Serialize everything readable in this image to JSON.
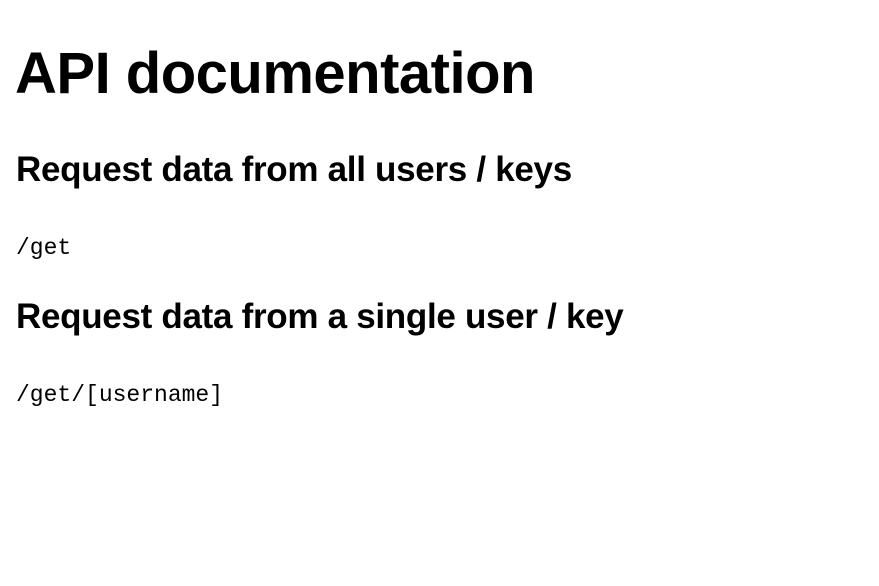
{
  "page": {
    "title": "API documentation",
    "sections": [
      {
        "heading": "Request data from all users / keys",
        "endpoint": "/get"
      },
      {
        "heading": "Request data from a single user / key",
        "endpoint": "/get/[username]"
      }
    ]
  }
}
